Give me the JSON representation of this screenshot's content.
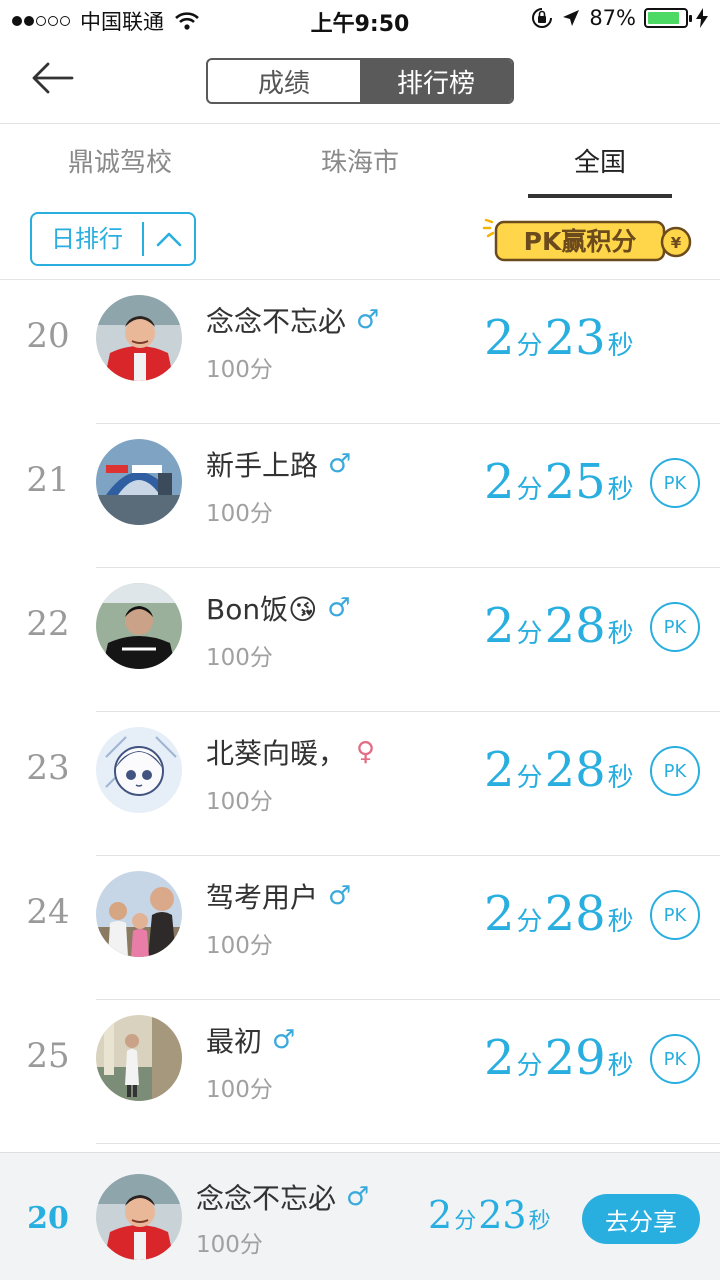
{
  "status_bar": {
    "carrier": "中国联通",
    "time": "上午9:50",
    "battery_text": "87%",
    "battery_level": 0.87
  },
  "nav": {
    "segments": [
      "成绩",
      "排行榜"
    ],
    "active_segment": 1
  },
  "region_tabs": {
    "items": [
      "鼎诚驾校",
      "珠海市",
      "全国"
    ],
    "active": 2
  },
  "filter": {
    "period_label": "日排行",
    "pk_banner_text": "PK赢积分"
  },
  "time_units": {
    "min": "分",
    "sec": "秒"
  },
  "pk_label": "PK",
  "ranking": [
    {
      "rank": "20",
      "name": "念念不忘必",
      "gender": "male",
      "score": "100分",
      "min": "2",
      "sec": "23",
      "pk": false,
      "avatar": "red-shirt-man"
    },
    {
      "rank": "21",
      "name": "新手上路",
      "gender": "male",
      "score": "100分",
      "min": "2",
      "sec": "25",
      "pk": true,
      "avatar": "police-station"
    },
    {
      "rank": "22",
      "name": "Bon饭😘",
      "gender": "male",
      "score": "100分",
      "min": "2",
      "sec": "28",
      "pk": true,
      "avatar": "young-man-dark"
    },
    {
      "rank": "23",
      "name": "北葵向暖，",
      "gender": "female",
      "score": "100分",
      "min": "2",
      "sec": "28",
      "pk": true,
      "avatar": "anime-girl"
    },
    {
      "rank": "24",
      "name": "驾考用户",
      "gender": "male",
      "score": "100分",
      "min": "2",
      "sec": "28",
      "pk": true,
      "avatar": "family-photo"
    },
    {
      "rank": "25",
      "name": "最初",
      "gender": "male",
      "score": "100分",
      "min": "2",
      "sec": "29",
      "pk": true,
      "avatar": "person-corridor"
    }
  ],
  "self": {
    "rank": "20",
    "name": "念念不忘必",
    "gender": "male",
    "score": "100分",
    "min": "2",
    "sec": "23",
    "share_label": "去分享"
  },
  "colors": {
    "accent": "#29aee0",
    "male": "#3aa9dc",
    "female": "#e36d84",
    "segment_active": "#5a5a5a"
  }
}
